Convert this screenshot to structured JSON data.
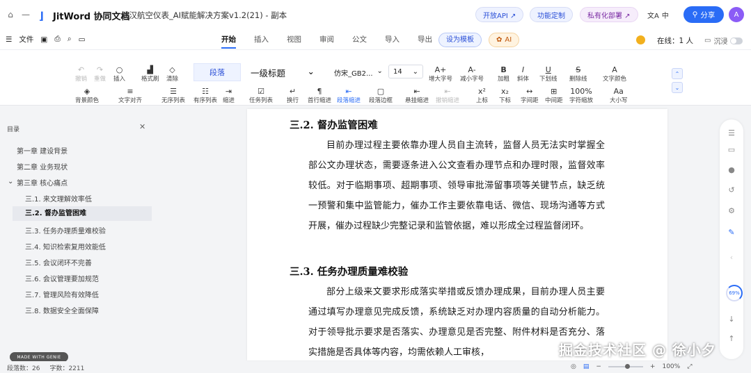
{
  "titlebar": {
    "app_name": "JitWord 协同文档",
    "doc_title": "武汉航空仪表_AI赋能解决方案v1.2(21) - 副本",
    "btn_api": "开放API ↗",
    "btn_custom": "功能定制",
    "btn_private": "私有化部署 ↗",
    "lang": "中",
    "share": "分享",
    "avatar": "A"
  },
  "menubar": {
    "file": "文件",
    "tabs": [
      "开始",
      "插入",
      "视图",
      "审阅",
      "公文",
      "导入",
      "导出"
    ],
    "active_tab": "开始",
    "template_btn": "设为模板",
    "ai_btn": "AI",
    "online": "在线：1 人",
    "immersive": "沉浸"
  },
  "toolbar": {
    "row1": {
      "undo": "撤销",
      "redo": "重做",
      "insert": "插入",
      "format_painter": "格式刷",
      "clear": "清除",
      "para_style": "段落",
      "heading": "一级标题",
      "font": "仿宋_GB2...",
      "size": "14",
      "grow": "增大字号",
      "shrink": "减小字号",
      "bold": "加粗",
      "italic": "斜体",
      "underline": "下划线",
      "strike": "删除线",
      "font_color": "文字颜色"
    },
    "row2": {
      "bg_color": "背景颜色",
      "align": "文字对齐",
      "unordered": "无序列表",
      "ordered": "有序列表",
      "indent": "缩进",
      "task": "任务列表",
      "line_break": "换行",
      "first_indent": "首行缩进",
      "para_spacing": "段落缩进",
      "para_border": "段落边框",
      "hanging": "悬挂缩进",
      "undo_para": "撤销缩进",
      "sup": "上标",
      "sub": "下标",
      "letter": "字间距",
      "code": "中间距",
      "width": "100%",
      "char_scale": "字符缩放",
      "case": "大小写"
    }
  },
  "sidebar": {
    "title": "目录",
    "items": [
      {
        "label": "第一章 建设背景",
        "level": 1
      },
      {
        "label": "第二章 业务现状",
        "level": 1
      },
      {
        "label": "第三章 核心痛点",
        "level": 1
      },
      {
        "label": "三.1. 来文理解效率低",
        "level": 2
      },
      {
        "label": "三.2. 督办监管困难",
        "level": 2
      },
      {
        "label": "三.3. 任务办理质量难校验",
        "level": 2
      },
      {
        "label": "三.4. 知识检索复用效能低",
        "level": 2
      },
      {
        "label": "三.5. 会议闭环不完善",
        "level": 2
      },
      {
        "label": "三.6. 会议管理要加规范",
        "level": 2
      },
      {
        "label": "三.7. 管理风险有效降低",
        "level": 2
      },
      {
        "label": "三.8. 数据安全全面保障",
        "level": 2
      }
    ],
    "active_index": 4,
    "made_with": "MADE WITH GENIE"
  },
  "document": {
    "section1_title": "三.2. 督办监管困难",
    "section1_body": "目前办理过程主要依靠办理人员自主流转，监督人员无法实时掌握全部公文办理状态，需要逐条进入公文查看办理节点和办理时限，监督效率较低。对于临期事项、超期事项、领导审批滞留事项等关键节点，缺乏统一预警和集中监管能力，催办工作主要依靠电话、微信、现场沟通等方式开展，催办过程缺少完整记录和监管依据，难以形成全过程监督闭环。",
    "section2_title": "三.3. 任务办理质量难校验",
    "section2_body": "部分上级来文要求形成落实举措或反馈办理成果，目前办理人员主要通过填写办理意见完成反馈，系统缺乏对办理内容质量的自动分析能力。对于领导批示要求是否落实、办理意见是否完整、附件材料是否充分、落实措施是否具体等内容，均需依赖人工审核，"
  },
  "rail": {
    "zoom": "69%"
  },
  "statusbar": {
    "para_count": "段落数：26",
    "word_count": "字数：2211",
    "zoom": "100%"
  },
  "watermark": "掘金技术社区 @ 徐小夕",
  "colors": {
    "accent": "#2a6cf6",
    "ai": "#c0560b",
    "purple": "#7a2ba3"
  }
}
